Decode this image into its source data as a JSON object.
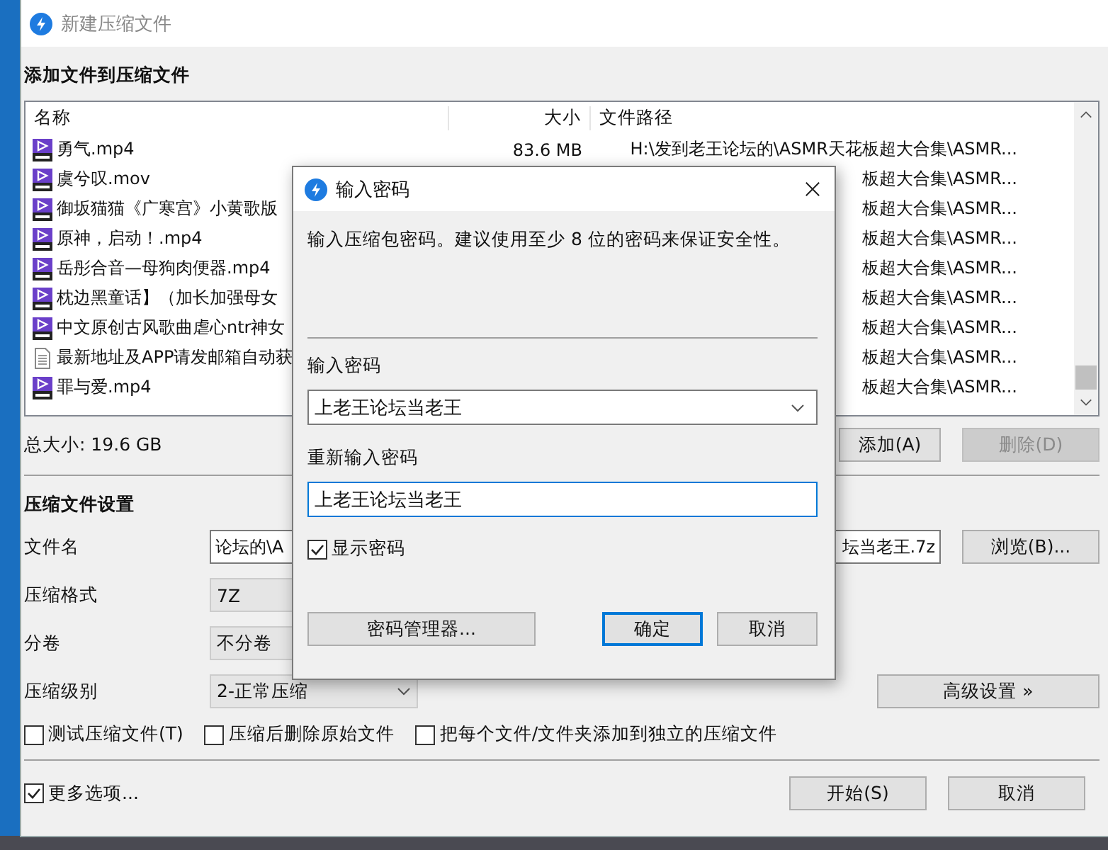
{
  "window": {
    "title": "新建压缩文件"
  },
  "files_section": {
    "heading": "添加文件到压缩文件",
    "columns": [
      "名称",
      "大小",
      "文件路径"
    ],
    "rows": [
      {
        "kind": "mp4",
        "name": "勇气.mp4",
        "size": "83.6 MB",
        "path": "H:\\发到老王论坛的\\ASMR天花板超大合集\\ASMR..."
      },
      {
        "kind": "mov",
        "name": "虞兮叹.mov",
        "path": "板超大合集\\ASMR..."
      },
      {
        "kind": "mp4",
        "name": "御坂猫猫《广寒宫》小黄歌版",
        "path": "板超大合集\\ASMR..."
      },
      {
        "kind": "mp4",
        "name": "原神，启动！.mp4",
        "path": "板超大合集\\ASMR..."
      },
      {
        "kind": "mp4",
        "name": "岳彤合音—母狗肉便器.mp4",
        "path": "板超大合集\\ASMR..."
      },
      {
        "kind": "mp4",
        "name": "枕边黑童话】（加长加强母女",
        "path": "板超大合集\\ASMR..."
      },
      {
        "kind": "mp4",
        "name": "中文原创古风歌曲虐心ntr神女",
        "path": "板超大合集\\ASMR..."
      },
      {
        "kind": "doc",
        "name": "最新地址及APP请发邮箱自动获",
        "path": "板超大合集\\ASMR..."
      },
      {
        "kind": "mp4",
        "name": "罪与爱.mp4",
        "path": "板超大合集\\ASMR..."
      }
    ],
    "total": "总大小: 19.6 GB",
    "buttons": [
      {
        "label": "添加(A)",
        "disabled": false
      },
      {
        "label": "删除(D)",
        "disabled": true
      }
    ]
  },
  "settings": {
    "heading": "压缩文件设置",
    "file_name": {
      "label": "文件名",
      "value_start": "论坛的\\A",
      "value_end": "坛当老王.7z",
      "browse": "浏览(B)..."
    },
    "format": {
      "label": "压缩格式",
      "value": "7Z"
    },
    "split": {
      "label": "分卷",
      "value": "不分卷"
    },
    "level": {
      "label": "压缩级别",
      "value": "2-正常压缩"
    },
    "advanced": "高级设置 »",
    "options": [
      {
        "label": "测试压缩文件(T)",
        "checked": false
      },
      {
        "label": "压缩后删除原始文件",
        "checked": false
      },
      {
        "label": "把每个文件/文件夹添加到独立的压缩文件",
        "checked": false
      }
    ]
  },
  "footer": {
    "more": {
      "label": "更多选项...",
      "checked": true
    },
    "buttons": [
      "开始(S)",
      "取消"
    ]
  },
  "dialog": {
    "title": "输入密码",
    "description": "输入压缩包密码。建议使用至少 8 位的密码来保证安全性。",
    "password_label": "输入密码",
    "password": "上老王论坛当老王",
    "confirm_label": "重新输入密码",
    "confirm": "上老王论坛当老王",
    "show_password": {
      "label": "显示密码",
      "checked": true
    },
    "manager": "密码管理器...",
    "ok": "确定",
    "cancel": "取消"
  }
}
